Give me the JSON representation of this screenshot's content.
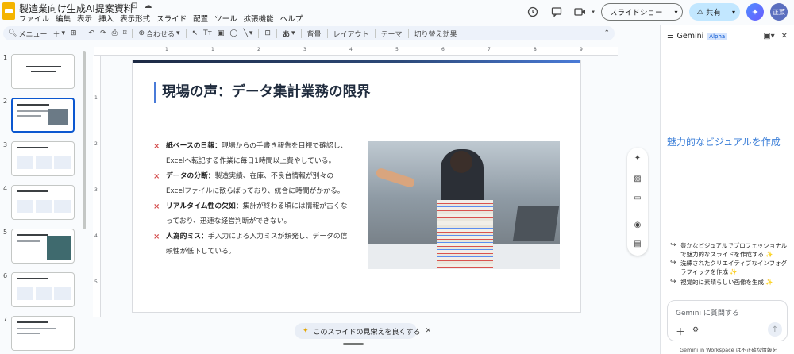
{
  "document": {
    "title": "製造業向け生成AI提案資料",
    "title_icons": [
      "☆",
      "⊡",
      "☁"
    ]
  },
  "menu": [
    "ファイル",
    "編集",
    "表示",
    "挿入",
    "表示形式",
    "スライド",
    "配置",
    "ツール",
    "拡張機能",
    "ヘルプ"
  ],
  "header_actions": {
    "slideshow_label": "スライドショー",
    "share_label": "共有",
    "avatar_text": "正菜"
  },
  "toolbar": {
    "menu_label": "メニュー",
    "zoom_label": "合わせる",
    "background_label": "背景",
    "layout_label": "レイアウト",
    "theme_label": "テーマ",
    "transition_label": "切り替え効果"
  },
  "filmstrip": {
    "slide_numbers": [
      "1",
      "2",
      "3",
      "4",
      "5",
      "6",
      "7"
    ],
    "active": "2"
  },
  "ruler": {
    "h_ticks": [
      "1",
      "1",
      "2",
      "3",
      "4",
      "5",
      "6",
      "7",
      "8",
      "9"
    ],
    "v_ticks": [
      "1",
      "2",
      "3",
      "4",
      "5"
    ]
  },
  "slide": {
    "title": "現場の声：データ集計業務の限界",
    "bullets": [
      {
        "head": "紙ベースの日報：",
        "body": "現場からの手書き報告を目視で確認し、Excelへ転記する作業に毎日1時間以上費やしている。"
      },
      {
        "head": "データの分断：",
        "body": "製造実績、在庫、不良台情報が別々のExcelファイルに散らばっており、統合に時間がかかる。"
      },
      {
        "head": "リアルタイム性の欠如：",
        "body": "集計が終わる頃には情報が古くなっており、迅速な経営判断ができない。"
      },
      {
        "head": "人為的ミス：",
        "body": "手入力による入力ミスが頻発し、データの信頼性が低下している。"
      }
    ],
    "bullet_mark": "×"
  },
  "improve_button": {
    "label": "このスライドの見栄えを良くする",
    "close": "✕"
  },
  "gemini": {
    "title": "Gemini",
    "badge": "Alpha",
    "hero": "魅力的なビジュアルを作成",
    "suggestions": [
      "豊かなビジュアルでプロフェッショナルで魅力的なスライドを作成する ✨",
      "洗練されたクリエイティブなインフォグラフィックを作成 ✨",
      "視覚的に素晴らしい画像を生成 ✨"
    ],
    "input_placeholder": "Gemini に質問する",
    "footer": "Gemini in Workspace は不正確な情報を"
  },
  "colors": {
    "accent": "#0b57d0",
    "share_bg": "#c2e7ff",
    "title_bar": "#4a7bd8",
    "bullet_mark": "#d44a4a",
    "gemini_hero": "#3c7fd8"
  }
}
